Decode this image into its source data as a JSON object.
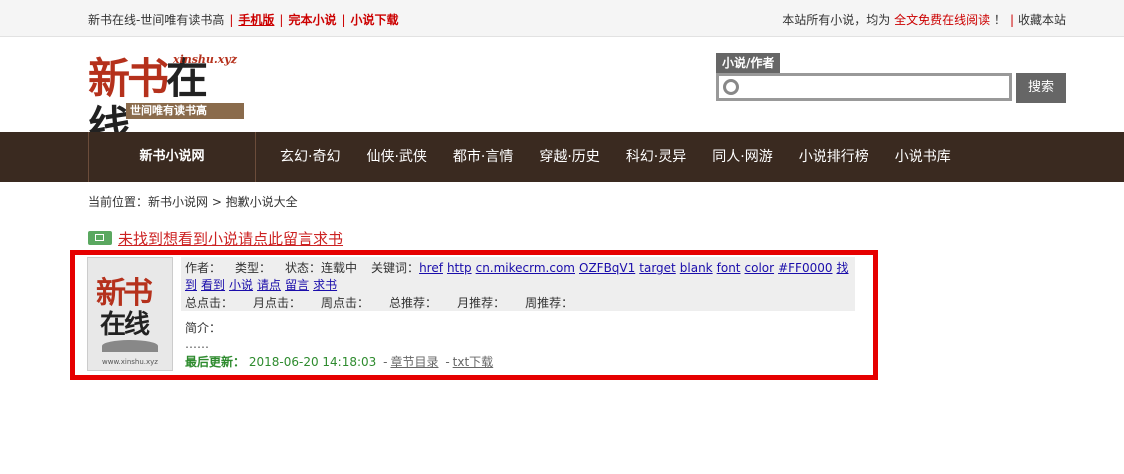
{
  "topbar": {
    "site_title": "新书在线-世间唯有读书高",
    "links": [
      "手机版",
      "完本小说",
      "小说下载"
    ],
    "notice_prefix": "本站所有小说，均为",
    "notice_highlight": "全文免费在线阅读",
    "notice_suffix": "！",
    "bookmark": "收藏本站"
  },
  "logo": {
    "char1": "新书",
    "char2": "在线",
    "site": "xinshu.xyz",
    "slogan": "世间唯有读书高"
  },
  "search": {
    "tab_label": "小说/作者",
    "placeholder": "",
    "button": "搜索"
  },
  "nav": {
    "home": "新书小说网",
    "items": [
      "玄幻·奇幻",
      "仙侠·武侠",
      "都市·言情",
      "穿越·历史",
      "科幻·灵异",
      "同人·网游",
      "小说排行榜",
      "小说书库"
    ]
  },
  "breadcrumb": "当前位置：新书小说网 > 抱歉小说大全",
  "banner_link": "未找到想看到小说请点此留言求书",
  "book": {
    "cover_t1": "新书",
    "cover_t2": "在线",
    "cover_url": "www.xinshu.xyz",
    "author_label": "作者：",
    "type_label": "类型：",
    "status": "状态：连载中",
    "keywords_label": "关键词：",
    "keywords": [
      "href",
      "http",
      "cn.mikecrm.com",
      "OZFBqV1",
      "target",
      "blank",
      "font",
      "color",
      "#FF0000",
      "找到",
      "看到",
      "小说",
      "请点",
      "留言",
      "求书"
    ],
    "stats": [
      "总点击：",
      "月点击：",
      "周点击：",
      "总推荐：",
      "月推荐：",
      "周推荐："
    ],
    "intro_label": "简介：",
    "intro_text": "……",
    "update_label": "最后更新：",
    "update_time": "2018-06-20 14:18:03",
    "chapter_link": "章节目录",
    "download_link": "txt下载"
  }
}
